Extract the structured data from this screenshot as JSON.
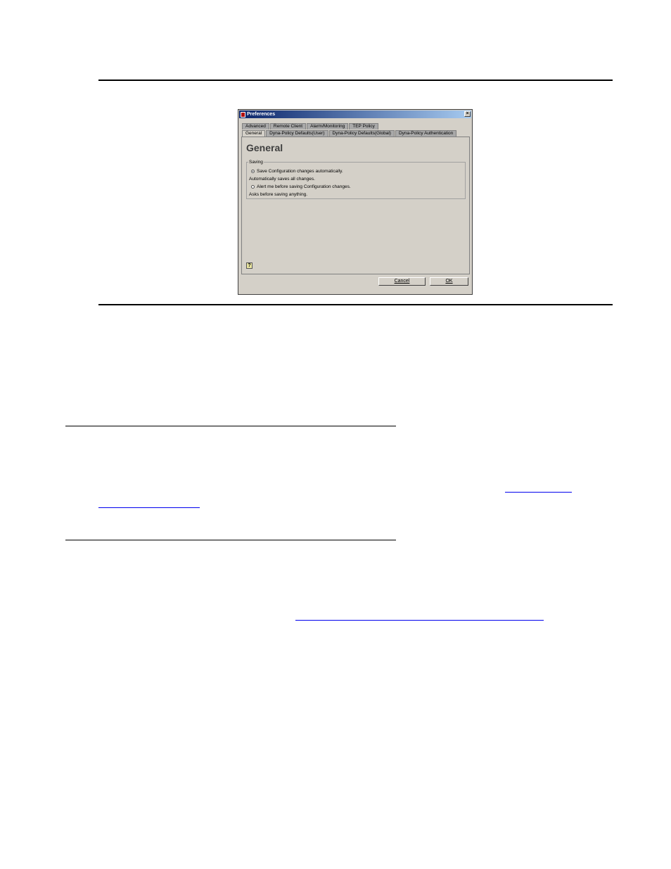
{
  "dialog": {
    "title": "Preferences",
    "close_symbol": "×",
    "tabs_row1": [
      "Advanced",
      "Remote Client",
      "Alarm/Monitoring",
      "TEP Policy"
    ],
    "tabs_row2": [
      "General",
      "Dyna-Policy Defaults(User)",
      "Dyna-Policy Defaults(Global)",
      "Dyna-Policy Authentication"
    ],
    "active_tab": "General",
    "panel_title": "General",
    "group_label": "Saving",
    "options": [
      {
        "label": "Save Configuration changes automatically.",
        "checked": true,
        "description": "Automatically saves all changes."
      },
      {
        "label": "Alert me before saving Configuration changes.",
        "checked": false,
        "description": "Asks before saving anything."
      }
    ],
    "help_icon": "?",
    "cancel_label": "Cancel",
    "ok_label": "OK"
  },
  "colors": {
    "dialog_bg": "#d4d0c8",
    "title_bar": "#0a246a",
    "link": "#0000ee"
  }
}
